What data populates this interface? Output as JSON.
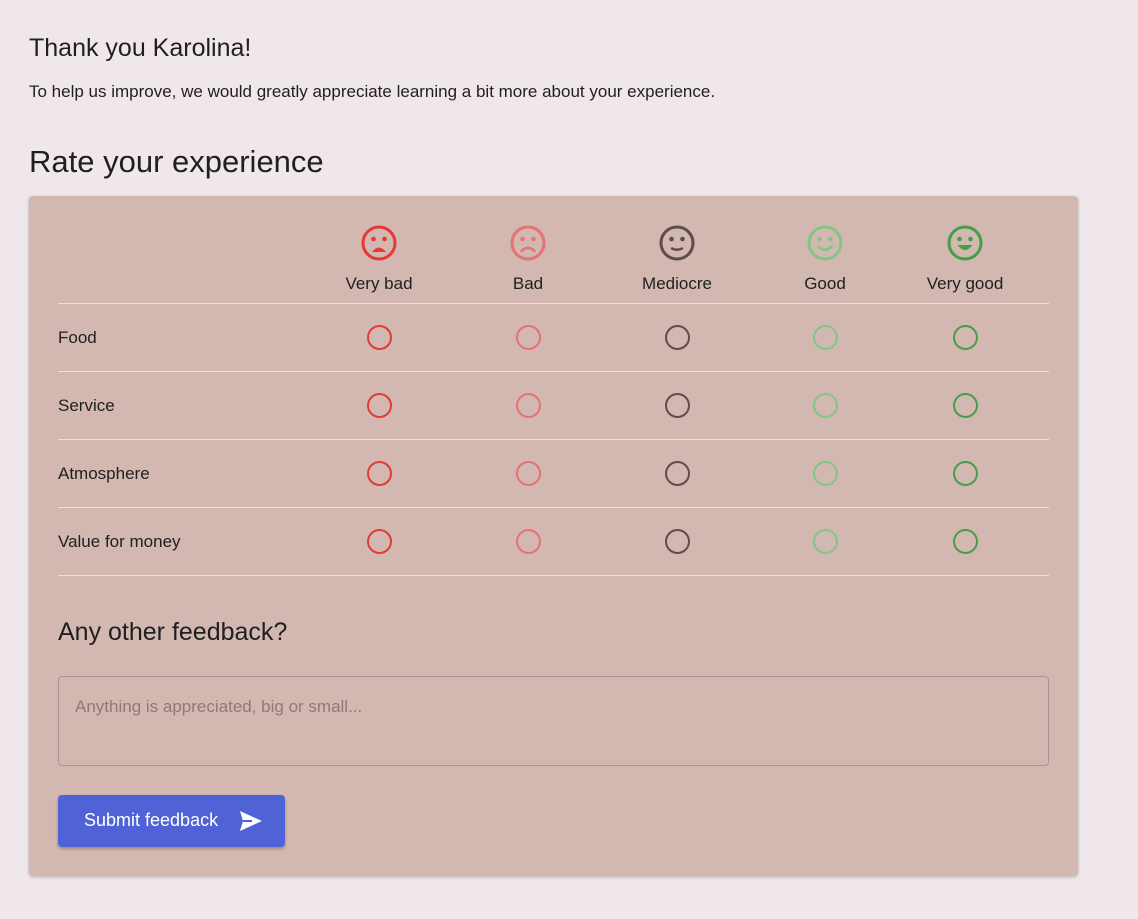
{
  "greeting": {
    "title": "Thank you Karolina!",
    "subtitle": "To help us improve, we would greatly appreciate learning a bit more about your experience."
  },
  "rating": {
    "title": "Rate your experience",
    "scale": [
      {
        "label": "Very bad",
        "icon": "very-dissatisfied-icon",
        "color": "#e53935"
      },
      {
        "label": "Bad",
        "icon": "dissatisfied-icon",
        "color": "#e57373"
      },
      {
        "label": "Mediocre",
        "icon": "neutral-icon",
        "color": "#5d4e4a"
      },
      {
        "label": "Good",
        "icon": "satisfied-icon",
        "color": "#81c784"
      },
      {
        "label": "Very good",
        "icon": "very-satisfied-icon",
        "color": "#43a047"
      }
    ],
    "categories": [
      {
        "label": "Food"
      },
      {
        "label": "Service"
      },
      {
        "label": "Atmosphere"
      },
      {
        "label": "Value for money"
      }
    ]
  },
  "feedback": {
    "title": "Any other feedback?",
    "placeholder": "Anything is appreciated, big or small...",
    "value": ""
  },
  "submit": {
    "label": "Submit feedback",
    "icon": "send-icon",
    "color": "#4f63d6"
  },
  "colors": {
    "background": "#f0e7ec",
    "card": "#d2b8b0"
  }
}
